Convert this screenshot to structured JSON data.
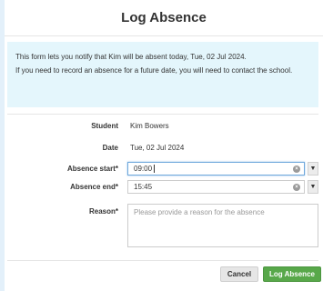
{
  "dialog": {
    "title": "Log Absence",
    "info_line1": "This form lets you notify that Kim will be absent today, Tue, 02 Jul 2024.",
    "info_line2": "If you need to record an absence for a future date, you will need to contact the school."
  },
  "form": {
    "student_label": "Student",
    "student_value": "Kim Bowers",
    "date_label": "Date",
    "date_value": "Tue, 02 Jul 2024",
    "start_label": "Absence start*",
    "start_value": "09:00",
    "end_label": "Absence end*",
    "end_value": "15:45",
    "reason_label": "Reason*",
    "reason_placeholder": "Please provide a reason for the absence",
    "clear_glyph": "×",
    "dropdown_glyph": "▼"
  },
  "footer": {
    "cancel_label": "Cancel",
    "submit_label": "Log Absence"
  },
  "colors": {
    "page_bg": "#e3f0fa",
    "info_bg": "#e4f6fc",
    "primary": "#58a84a"
  }
}
